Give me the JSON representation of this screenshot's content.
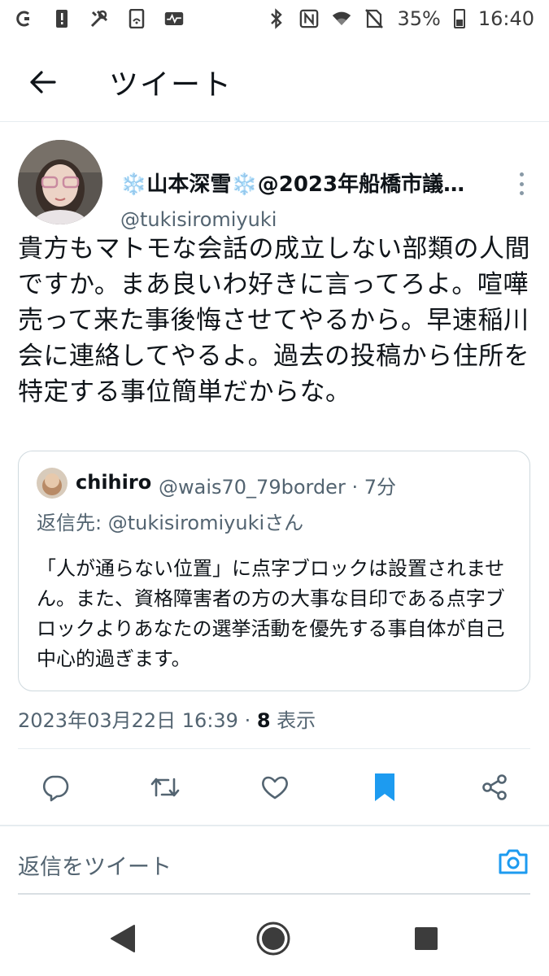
{
  "status_bar": {
    "battery_percent": "35%",
    "time": "16:40",
    "icons": [
      "notification-icon",
      "alert-icon",
      "tools-icon",
      "sim-icon",
      "activity-icon",
      "bluetooth-icon",
      "nfc-icon",
      "wifi-icon",
      "no-signal-icon",
      "battery-icon"
    ]
  },
  "header": {
    "title": "ツイート",
    "back_icon": "arrow-left-icon"
  },
  "tweet": {
    "author_name": "❄️山本深雪❄️@2023年船橋市議…",
    "author_handle": "@tukisiromiyuki",
    "body": "貴方もマトモな会話の成立しない部類の人間ですか。まあ良いわ好きに言ってろよ。喧嘩売って来た事後悔させてやるから。早速稲川会に連絡してやるよ。過去の投稿から住所を特定する事位簡単だからな。",
    "quote": {
      "name": "chihiro",
      "meta": "@wais70_79border · 7分",
      "reply_prefix": "返信先: ",
      "reply_handle": "@tukisiromiyuki",
      "reply_suffix": "さん",
      "body": "「人が通らない位置」に点字ブロックは設置されません。また、資格障害者の方の大事な目印である点字ブロックよりあなたの選挙活動を優先する事自体が自己中心的過ぎます。"
    },
    "timestamp": "2023年03月22日 16:39 · ",
    "views_count": "8",
    "views_label": " 表示",
    "actions": [
      "reply-icon",
      "retweet-icon",
      "like-icon",
      "bookmark-icon",
      "share-icon"
    ],
    "accent_color": "#1d9bf0"
  },
  "reply_bar": {
    "placeholder": "返信をツイート",
    "camera_icon": "camera-icon"
  },
  "nav_bar": [
    "back-triangle-icon",
    "home-circle-icon",
    "recents-square-icon"
  ]
}
